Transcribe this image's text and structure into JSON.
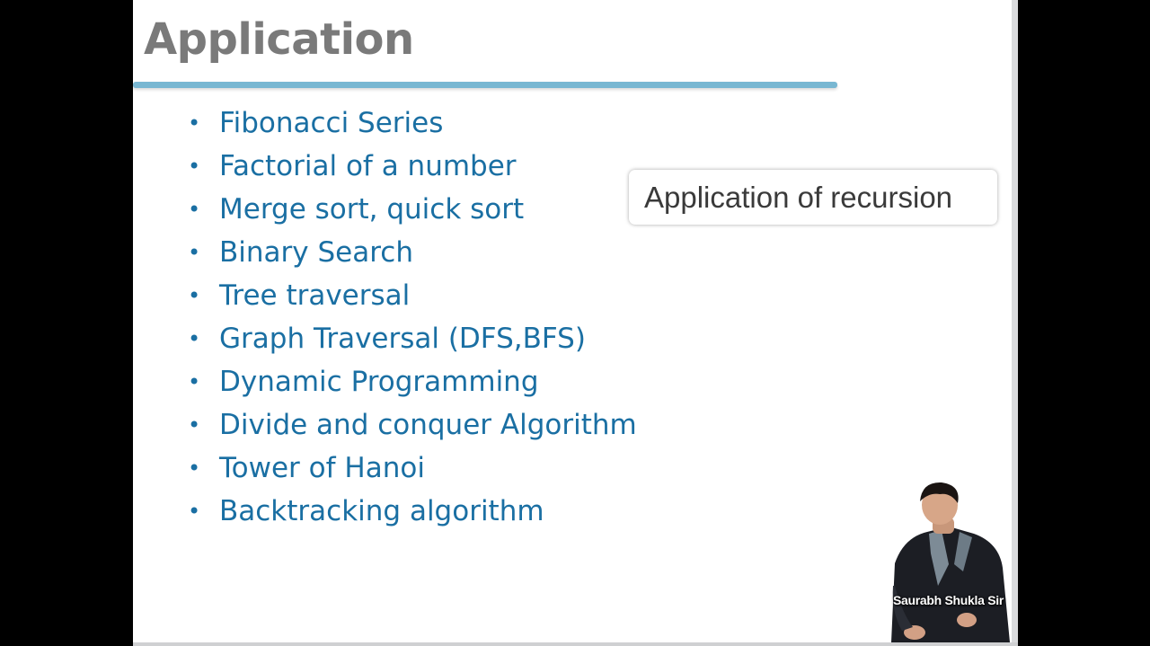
{
  "slide": {
    "title": "Application",
    "bullets": [
      "Fibonacci Series",
      "Factorial of a number",
      "Merge sort, quick sort",
      "Binary Search",
      "Tree traversal",
      "Graph Traversal (DFS,BFS)",
      "Dynamic Programming",
      "Divide and conquer Algorithm",
      "Tower of Hanoi",
      "Backtracking algorithm"
    ],
    "bullet_glyph": "•"
  },
  "callout": {
    "text": "Application of recursion"
  },
  "presenter": {
    "caption": "Saurabh Shukla Sir",
    "icon": "presenter-photo"
  },
  "colors": {
    "title": "#7a7a7a",
    "bullet_text": "#1a6fa3",
    "title_rule": "#78b7d2",
    "frame": "#000000"
  }
}
